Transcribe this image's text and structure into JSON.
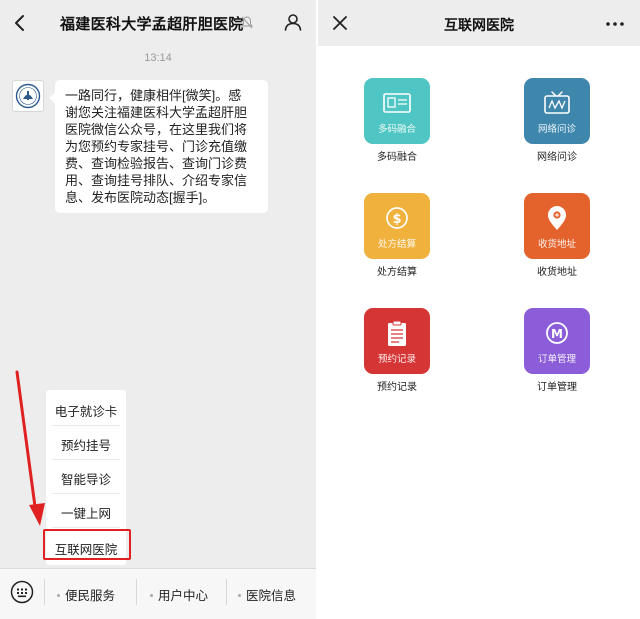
{
  "chat": {
    "title": "福建医科大学孟超肝胆医院",
    "time": "13:14",
    "message_lines": [
      "一路同行，健康相伴[微笑]。感",
      "谢您关注福建医科大学孟超肝胆",
      "医院微信公众号，在这里我们将",
      "为您预约专家挂号、门诊充值缴",
      "费、查询检验报告、查询门诊费",
      "用、查询挂号排队、介绍专家信",
      "息、发布医院动态[握手]。"
    ],
    "menu": [
      "电子就诊卡",
      "预约挂号",
      "智能导诊",
      "一键上网",
      "互联网医院"
    ],
    "bottom_tabs": [
      "便民服务",
      "用户中心",
      "医院信息"
    ]
  },
  "web": {
    "title": "互联网医院",
    "tiles": [
      {
        "label": "多码融合",
        "color": "#4fc6c3",
        "icon": "id-card-icon"
      },
      {
        "label": "网络问诊",
        "color": "#3f86ad",
        "icon": "tv-consult-icon"
      },
      {
        "label": "处方结算",
        "color": "#f0b23d",
        "icon": "dollar-icon"
      },
      {
        "label": "收货地址",
        "color": "#e4632d",
        "icon": "location-pin-icon"
      },
      {
        "label": "预约记录",
        "color": "#d53535",
        "icon": "clipboard-icon"
      },
      {
        "label": "订单管理",
        "color": "#8b5dd8",
        "icon": "m-badge-icon"
      }
    ]
  },
  "colors": {
    "highlight": "#e02121",
    "bg": "#ededed"
  }
}
